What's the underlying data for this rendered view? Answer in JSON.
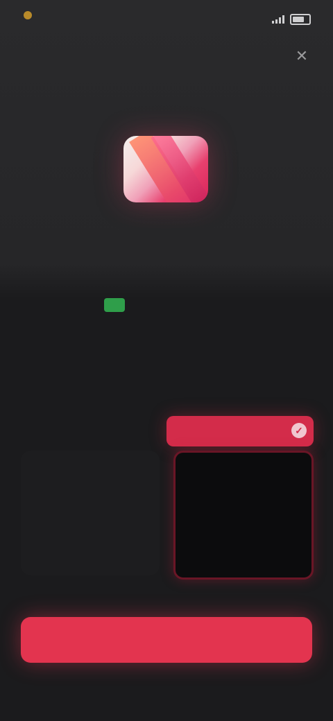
{
  "status_bar": {
    "time": "",
    "icons": [
      "signal-icon",
      "battery-icon"
    ]
  },
  "close_icon": "close-icon",
  "hero": {
    "icon": "app-icon"
  },
  "offer": {
    "tag": "",
    "title_line1": "",
    "title_line2": ""
  },
  "plans": {
    "badge": "",
    "hint": "",
    "left": {
      "period": "",
      "price": "",
      "sub": ""
    },
    "right": {
      "period": "",
      "price": "",
      "sub": ""
    }
  },
  "cta": {
    "label": ""
  },
  "colors": {
    "background": "#1f1f21",
    "accent": "#e3344f",
    "offer_tag_green": "#2f9e4a",
    "selected_border": "#6a1626"
  }
}
